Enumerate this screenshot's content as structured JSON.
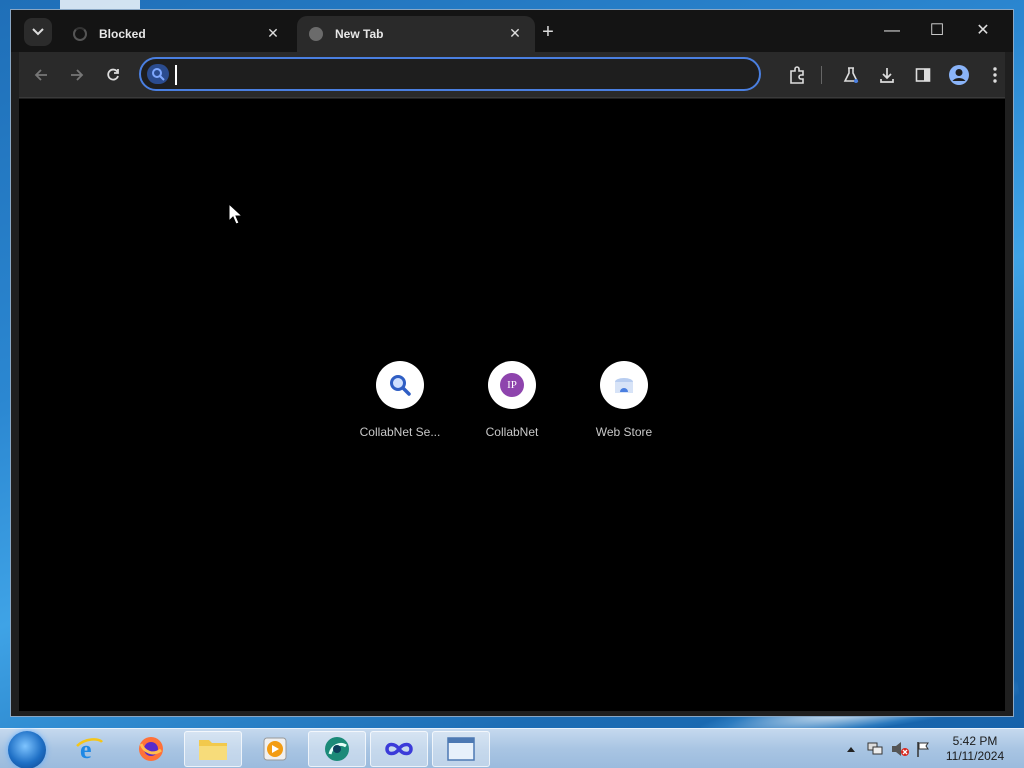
{
  "browser": {
    "tabs": [
      {
        "title": "Blocked",
        "active": false
      },
      {
        "title": "New Tab",
        "active": true
      }
    ],
    "new_tab_label": "+",
    "omnibox": {
      "value": "",
      "placeholder": ""
    },
    "window_controls": {
      "minimize": "—",
      "maximize": "☐",
      "close": "✕"
    }
  },
  "new_tab_page": {
    "shortcuts": [
      {
        "label": "CollabNet Se...",
        "icon": "search-icon"
      },
      {
        "label": "CollabNet",
        "icon": "ip-badge-icon",
        "badge_text": "IP"
      },
      {
        "label": "Web Store",
        "icon": "web-store-icon"
      }
    ]
  },
  "taskbar": {
    "apps": [
      "internet-explorer",
      "firefox",
      "file-explorer",
      "media-player",
      "chrome-like",
      "infinity-app",
      "window-app"
    ],
    "clock": {
      "time": "5:42 PM",
      "date": "11/11/2024"
    }
  },
  "colors": {
    "omnibox_border": "#4a7fe0",
    "page_background": "#000000",
    "ip_badge": "#8e44ad"
  }
}
